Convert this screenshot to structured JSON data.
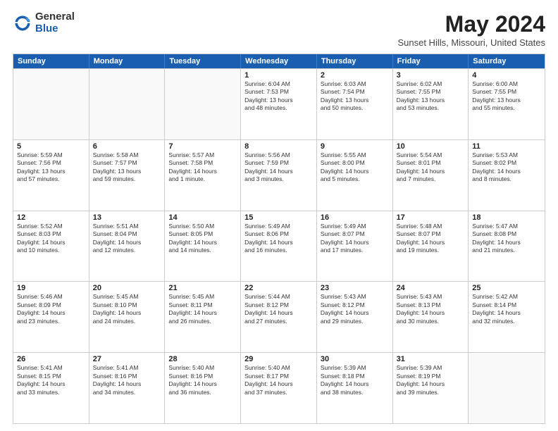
{
  "logo": {
    "general": "General",
    "blue": "Blue"
  },
  "title": "May 2024",
  "subtitle": "Sunset Hills, Missouri, United States",
  "days_of_week": [
    "Sunday",
    "Monday",
    "Tuesday",
    "Wednesday",
    "Thursday",
    "Friday",
    "Saturday"
  ],
  "weeks": [
    [
      {
        "day": "",
        "lines": []
      },
      {
        "day": "",
        "lines": []
      },
      {
        "day": "",
        "lines": []
      },
      {
        "day": "1",
        "lines": [
          "Sunrise: 6:04 AM",
          "Sunset: 7:53 PM",
          "Daylight: 13 hours",
          "and 48 minutes."
        ]
      },
      {
        "day": "2",
        "lines": [
          "Sunrise: 6:03 AM",
          "Sunset: 7:54 PM",
          "Daylight: 13 hours",
          "and 50 minutes."
        ]
      },
      {
        "day": "3",
        "lines": [
          "Sunrise: 6:02 AM",
          "Sunset: 7:55 PM",
          "Daylight: 13 hours",
          "and 53 minutes."
        ]
      },
      {
        "day": "4",
        "lines": [
          "Sunrise: 6:00 AM",
          "Sunset: 7:55 PM",
          "Daylight: 13 hours",
          "and 55 minutes."
        ]
      }
    ],
    [
      {
        "day": "5",
        "lines": [
          "Sunrise: 5:59 AM",
          "Sunset: 7:56 PM",
          "Daylight: 13 hours",
          "and 57 minutes."
        ]
      },
      {
        "day": "6",
        "lines": [
          "Sunrise: 5:58 AM",
          "Sunset: 7:57 PM",
          "Daylight: 13 hours",
          "and 59 minutes."
        ]
      },
      {
        "day": "7",
        "lines": [
          "Sunrise: 5:57 AM",
          "Sunset: 7:58 PM",
          "Daylight: 14 hours",
          "and 1 minute."
        ]
      },
      {
        "day": "8",
        "lines": [
          "Sunrise: 5:56 AM",
          "Sunset: 7:59 PM",
          "Daylight: 14 hours",
          "and 3 minutes."
        ]
      },
      {
        "day": "9",
        "lines": [
          "Sunrise: 5:55 AM",
          "Sunset: 8:00 PM",
          "Daylight: 14 hours",
          "and 5 minutes."
        ]
      },
      {
        "day": "10",
        "lines": [
          "Sunrise: 5:54 AM",
          "Sunset: 8:01 PM",
          "Daylight: 14 hours",
          "and 7 minutes."
        ]
      },
      {
        "day": "11",
        "lines": [
          "Sunrise: 5:53 AM",
          "Sunset: 8:02 PM",
          "Daylight: 14 hours",
          "and 8 minutes."
        ]
      }
    ],
    [
      {
        "day": "12",
        "lines": [
          "Sunrise: 5:52 AM",
          "Sunset: 8:03 PM",
          "Daylight: 14 hours",
          "and 10 minutes."
        ]
      },
      {
        "day": "13",
        "lines": [
          "Sunrise: 5:51 AM",
          "Sunset: 8:04 PM",
          "Daylight: 14 hours",
          "and 12 minutes."
        ]
      },
      {
        "day": "14",
        "lines": [
          "Sunrise: 5:50 AM",
          "Sunset: 8:05 PM",
          "Daylight: 14 hours",
          "and 14 minutes."
        ]
      },
      {
        "day": "15",
        "lines": [
          "Sunrise: 5:49 AM",
          "Sunset: 8:06 PM",
          "Daylight: 14 hours",
          "and 16 minutes."
        ]
      },
      {
        "day": "16",
        "lines": [
          "Sunrise: 5:49 AM",
          "Sunset: 8:07 PM",
          "Daylight: 14 hours",
          "and 17 minutes."
        ]
      },
      {
        "day": "17",
        "lines": [
          "Sunrise: 5:48 AM",
          "Sunset: 8:07 PM",
          "Daylight: 14 hours",
          "and 19 minutes."
        ]
      },
      {
        "day": "18",
        "lines": [
          "Sunrise: 5:47 AM",
          "Sunset: 8:08 PM",
          "Daylight: 14 hours",
          "and 21 minutes."
        ]
      }
    ],
    [
      {
        "day": "19",
        "lines": [
          "Sunrise: 5:46 AM",
          "Sunset: 8:09 PM",
          "Daylight: 14 hours",
          "and 23 minutes."
        ]
      },
      {
        "day": "20",
        "lines": [
          "Sunrise: 5:45 AM",
          "Sunset: 8:10 PM",
          "Daylight: 14 hours",
          "and 24 minutes."
        ]
      },
      {
        "day": "21",
        "lines": [
          "Sunrise: 5:45 AM",
          "Sunset: 8:11 PM",
          "Daylight: 14 hours",
          "and 26 minutes."
        ]
      },
      {
        "day": "22",
        "lines": [
          "Sunrise: 5:44 AM",
          "Sunset: 8:12 PM",
          "Daylight: 14 hours",
          "and 27 minutes."
        ]
      },
      {
        "day": "23",
        "lines": [
          "Sunrise: 5:43 AM",
          "Sunset: 8:12 PM",
          "Daylight: 14 hours",
          "and 29 minutes."
        ]
      },
      {
        "day": "24",
        "lines": [
          "Sunrise: 5:43 AM",
          "Sunset: 8:13 PM",
          "Daylight: 14 hours",
          "and 30 minutes."
        ]
      },
      {
        "day": "25",
        "lines": [
          "Sunrise: 5:42 AM",
          "Sunset: 8:14 PM",
          "Daylight: 14 hours",
          "and 32 minutes."
        ]
      }
    ],
    [
      {
        "day": "26",
        "lines": [
          "Sunrise: 5:41 AM",
          "Sunset: 8:15 PM",
          "Daylight: 14 hours",
          "and 33 minutes."
        ]
      },
      {
        "day": "27",
        "lines": [
          "Sunrise: 5:41 AM",
          "Sunset: 8:16 PM",
          "Daylight: 14 hours",
          "and 34 minutes."
        ]
      },
      {
        "day": "28",
        "lines": [
          "Sunrise: 5:40 AM",
          "Sunset: 8:16 PM",
          "Daylight: 14 hours",
          "and 36 minutes."
        ]
      },
      {
        "day": "29",
        "lines": [
          "Sunrise: 5:40 AM",
          "Sunset: 8:17 PM",
          "Daylight: 14 hours",
          "and 37 minutes."
        ]
      },
      {
        "day": "30",
        "lines": [
          "Sunrise: 5:39 AM",
          "Sunset: 8:18 PM",
          "Daylight: 14 hours",
          "and 38 minutes."
        ]
      },
      {
        "day": "31",
        "lines": [
          "Sunrise: 5:39 AM",
          "Sunset: 8:19 PM",
          "Daylight: 14 hours",
          "and 39 minutes."
        ]
      },
      {
        "day": "",
        "lines": []
      }
    ]
  ],
  "colors": {
    "header_bg": "#1a5faf",
    "header_text": "#ffffff",
    "border": "#cccccc",
    "shaded": "#f0f0f0"
  }
}
